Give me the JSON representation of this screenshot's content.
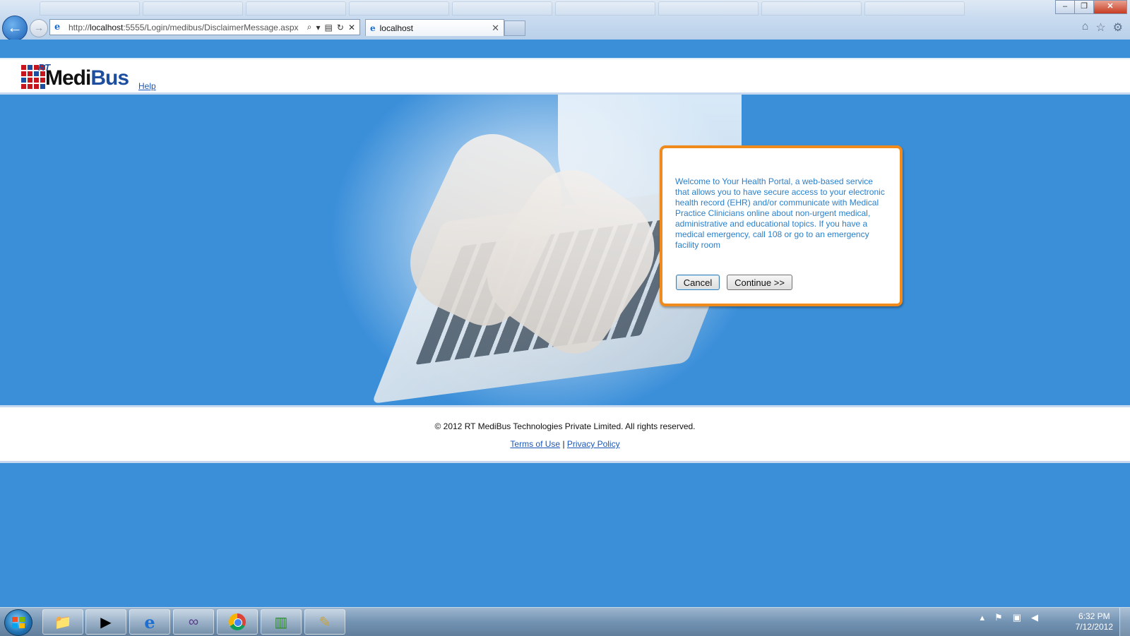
{
  "browser": {
    "address_url_prefix": "http://",
    "address_url_host": "localhost",
    "address_url_rest": ":5555/Login/medibus/DisclaimerMessage.aspx",
    "tab_title": "localhost",
    "window_controls": {
      "minimize": "–",
      "maximize": "❐",
      "close": "✕"
    },
    "toolbar_icons": [
      "home-icon",
      "favorites-star-icon",
      "tools-gear-icon"
    ]
  },
  "header": {
    "logo_rt": "RT",
    "logo_medi": "Medi",
    "logo_bus": "Bus",
    "help_link": "Help"
  },
  "dialog": {
    "message": "Welcome to Your Health Portal, a web-based service that allows you to have secure access to your electronic health record (EHR) and/or communicate with Medical Practice Clinicians online about non-urgent medical, administrative and educational topics. If you have a medical emergency, call 108 or go to an emergency facility room",
    "cancel_label": "Cancel",
    "continue_label": "Continue >>"
  },
  "footer": {
    "copyright": "© 2012 RT MediBus Technologies Private Limited. All rights reserved.",
    "terms_link": "Terms of Use",
    "separator": "|",
    "privacy_link": "Privacy Policy"
  },
  "taskbar": {
    "pinned": [
      "windows-explorer-icon",
      "media-player-icon",
      "internet-explorer-icon",
      "visual-studio-icon",
      "chrome-icon",
      "task-manager-icon",
      "sql-tools-icon"
    ],
    "clock_time": "6:32 PM",
    "clock_date": "7/12/2012"
  },
  "colors": {
    "page_blue": "#3b8fd9",
    "dialog_border": "#f08a1c",
    "dialog_text": "#2a7fc9",
    "link": "#1a57b8",
    "logo_red": "#c4161c",
    "logo_blue": "#1d4f9e"
  }
}
